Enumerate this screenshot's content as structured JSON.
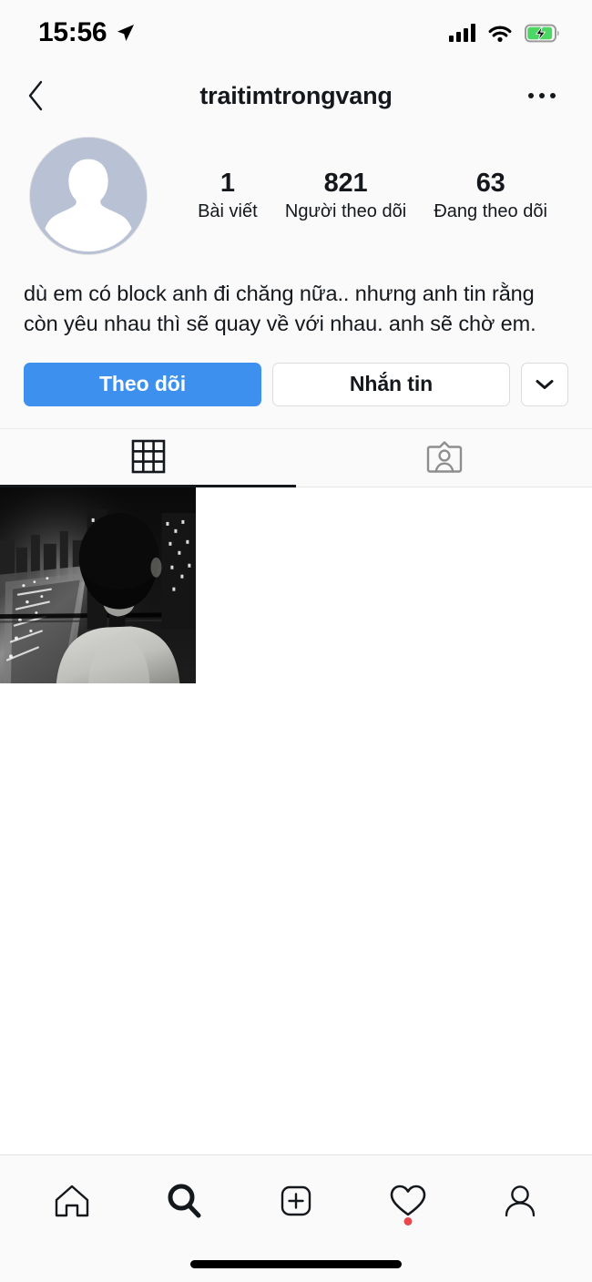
{
  "status_bar": {
    "time": "15:56",
    "location_icon": "location-arrow-icon",
    "signal_icon": "cellular-signal-icon",
    "wifi_icon": "wifi-icon",
    "battery_icon": "battery-charging-icon",
    "battery_color": "#4cd764"
  },
  "nav": {
    "back_icon": "chevron-left-icon",
    "title": "traitimtrongvang",
    "more_icon": "more-options-icon"
  },
  "profile": {
    "avatar_icon": "default-avatar-icon",
    "stats": [
      {
        "value": "1",
        "label": "Bài viết"
      },
      {
        "value": "821",
        "label": "Người theo dõi"
      },
      {
        "value": "63",
        "label": "Đang theo dõi"
      }
    ],
    "bio": "dù em có block anh đi chăng nữa.. nhưng anh tin rằng còn yêu nhau thì sẽ quay về với nhau. anh sẽ chờ em."
  },
  "actions": {
    "follow_label": "Theo dõi",
    "follow_color": "#3e90ee",
    "message_label": "Nhắn tin",
    "chevron_icon": "chevron-down-icon"
  },
  "tabs": [
    {
      "name": "grid-tab",
      "icon": "grid-icon",
      "active": true
    },
    {
      "name": "tagged-tab",
      "icon": "tagged-person-icon",
      "active": false
    }
  ],
  "posts": [
    {
      "alt": "black and white night cityscape with person from behind"
    }
  ],
  "bottom_nav": [
    {
      "name": "home",
      "icon": "home-icon",
      "badge": false
    },
    {
      "name": "search",
      "icon": "search-icon",
      "badge": false
    },
    {
      "name": "add-post",
      "icon": "plus-square-icon",
      "badge": false
    },
    {
      "name": "activity",
      "icon": "heart-icon",
      "badge": true
    },
    {
      "name": "profile",
      "icon": "person-icon",
      "badge": false
    }
  ],
  "home_indicator": "home-indicator-bar"
}
